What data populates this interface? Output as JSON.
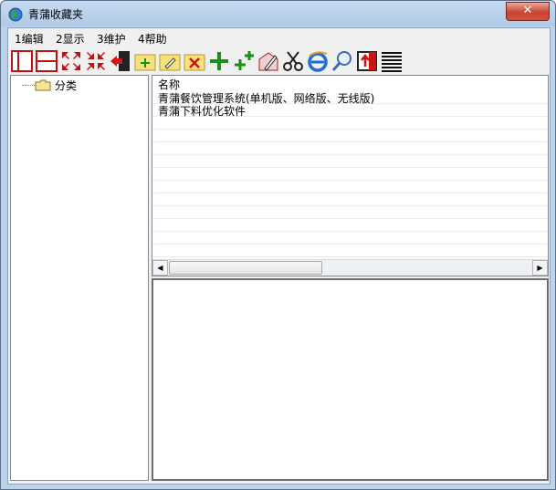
{
  "window": {
    "title": "青蒲收藏夹",
    "close_label": "✕"
  },
  "menu": [
    {
      "label": "1编辑"
    },
    {
      "label": "2显示"
    },
    {
      "label": "3维护"
    },
    {
      "label": "4帮助"
    }
  ],
  "toolbar": {
    "buttons": [
      "split-vertical-icon",
      "split-horizontal-icon",
      "expand-icon",
      "collapse-icon",
      "exit-icon",
      "new-folder-icon",
      "rename-folder-icon",
      "delete-folder-icon",
      "add-icon",
      "add-multiple-icon",
      "edit-icon",
      "cut-icon",
      "browser-icon",
      "search-icon",
      "export-icon",
      "list-icon"
    ]
  },
  "tree": {
    "root_label": "分类"
  },
  "list": {
    "column_header": "名称",
    "rows": [
      {
        "name": "青蒲餐饮管理系统(单机版、网络版、无线版)"
      },
      {
        "name": "青蒲下料优化软件"
      }
    ]
  },
  "colors": {
    "accent": "#c8432f",
    "titlebar": "#b9d1ea",
    "green": "#1a8f1a",
    "red": "#d01010"
  }
}
